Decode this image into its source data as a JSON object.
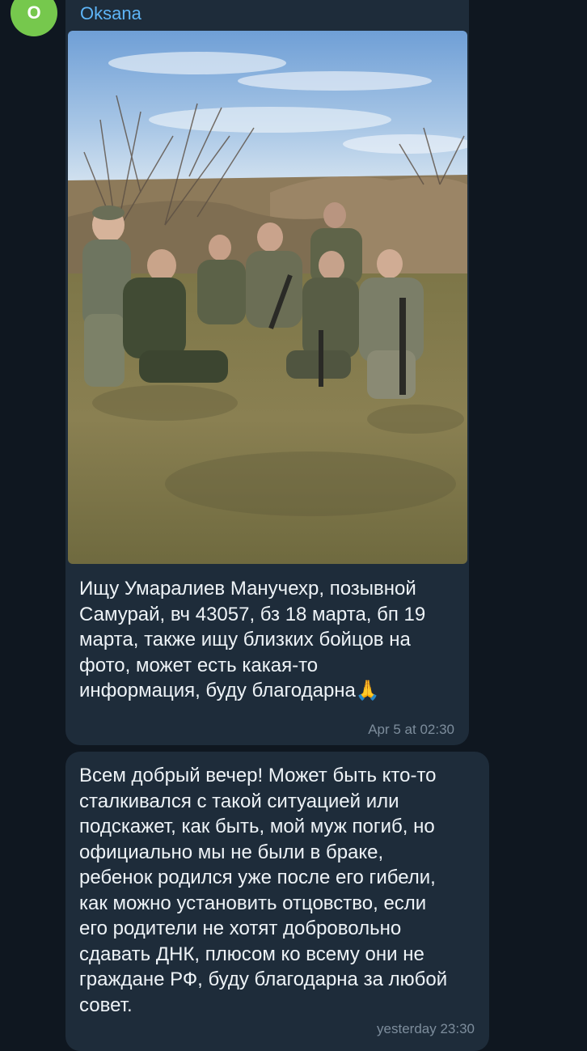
{
  "chat": {
    "avatar_letter": "O",
    "sender_name": "Oksana",
    "messages": [
      {
        "text": "Ищу Умаралиев Манучехр, позывной\nСамурай, вч 43057, бз 18 марта, бп 19\nмарта, также ищу близких бойцов на\nфото, может есть какая-то\nинформация, буду благодарна🙏",
        "time": "Apr 5 at 02:30",
        "has_photo": true
      },
      {
        "text": "Всем добрый вечер! Может быть кто-то\nсталкивался с такой ситуацией или\nподскажет, как быть, мой муж погиб, но\nофициально мы не были в браке,\nребенок родился уже после его гибели,\nкак можно установить отцовство, если\nего родители не хотят добровольно\nсдавать ДНК, плюсом ко всему они не\nграждане РФ, буду благодарна за любой\nсовет.",
        "time": "yesterday 23:30"
      }
    ]
  },
  "colors": {
    "background": "#0f1720",
    "bubble": "#1e2c3a",
    "accent_name": "#5eb5f7",
    "avatar": "#76c84d",
    "text": "#eef3f7",
    "time": "#7d8d9c"
  }
}
